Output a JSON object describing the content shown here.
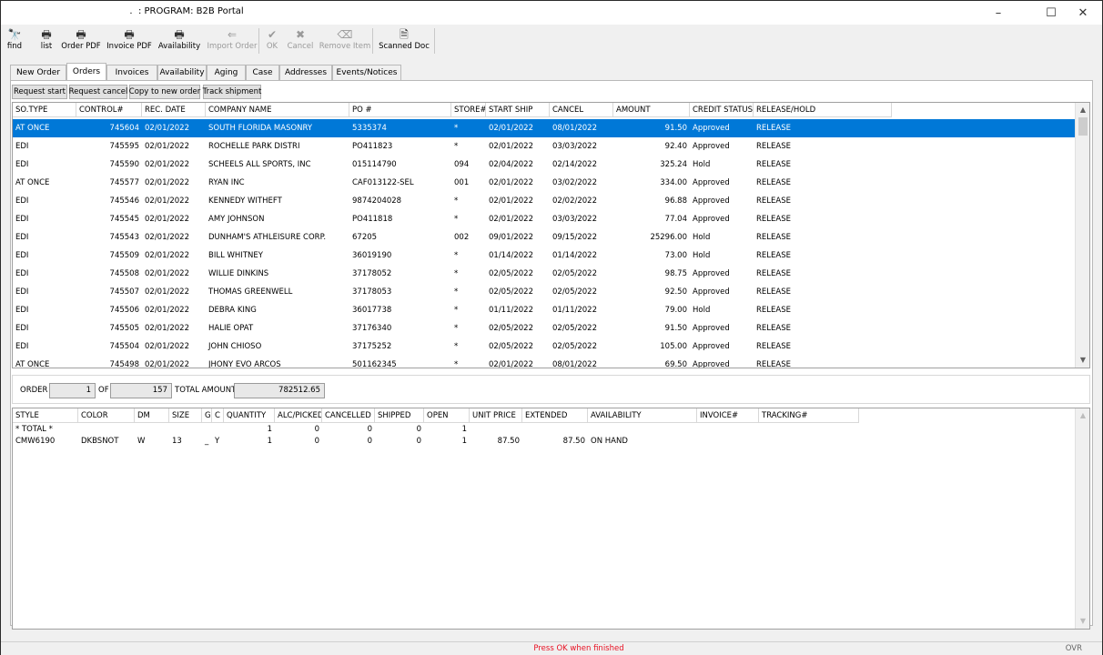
{
  "window": {
    "title": "        .  : PROGRAM: B2B Portal"
  },
  "toolbar": [
    {
      "label": "find",
      "icon": "binoculars-icon",
      "glyph": "🔭",
      "disabled": false
    },
    {
      "label": "list",
      "icon": "printer-icon",
      "glyph": "🖶",
      "disabled": false
    },
    {
      "label": "Order PDF",
      "icon": "printer-icon",
      "glyph": "🖶",
      "disabled": false
    },
    {
      "label": "Invoice PDF",
      "icon": "printer-icon",
      "glyph": "🖶",
      "disabled": false
    },
    {
      "label": "Availability",
      "icon": "printer-icon",
      "glyph": "🖶",
      "disabled": false
    },
    {
      "label": "Import Order",
      "icon": "import-icon",
      "glyph": "⇐",
      "disabled": true
    },
    {
      "label": "OK",
      "icon": "checkmark-icon",
      "glyph": "✔",
      "disabled": true
    },
    {
      "label": "Cancel",
      "icon": "x-icon",
      "glyph": "✖",
      "disabled": true
    },
    {
      "label": "Remove Item",
      "icon": "eraser-icon",
      "glyph": "⌫",
      "disabled": true
    },
    {
      "label": "Scanned Doc",
      "icon": "document-icon",
      "glyph": "🗎",
      "disabled": false
    }
  ],
  "tabs": [
    "New Order",
    "Orders",
    "Invoices",
    "Availability",
    "Aging",
    "Case",
    "Addresses",
    "Events/Notices"
  ],
  "active_tab": "Orders",
  "actions": [
    "Request start",
    "Request cancel",
    "Copy to new order",
    "Track shipment"
  ],
  "orders": {
    "columns": [
      "SO.TYPE",
      "CONTROL#",
      "REC. DATE",
      "COMPANY NAME",
      "PO #",
      "STORE#",
      "START SHIP",
      "CANCEL",
      "AMOUNT",
      "CREDIT STATUS",
      "RELEASE/HOLD"
    ],
    "rows": [
      [
        "AT ONCE",
        "745604",
        "02/01/2022",
        "SOUTH FLORIDA MASONRY",
        "5335374",
        "*",
        "02/01/2022",
        "08/01/2022",
        "91.50",
        "Approved",
        "RELEASE"
      ],
      [
        "EDI",
        "745595",
        "02/01/2022",
        "ROCHELLE PARK DISTRI",
        "PO411823",
        "*",
        "02/01/2022",
        "03/03/2022",
        "92.40",
        "Approved",
        "RELEASE"
      ],
      [
        "EDI",
        "745590",
        "02/01/2022",
        "SCHEELS ALL SPORTS, INC",
        "015114790",
        "094",
        "02/04/2022",
        "02/14/2022",
        "325.24",
        "Hold",
        "RELEASE"
      ],
      [
        "AT ONCE",
        "745577",
        "02/01/2022",
        "RYAN INC",
        "CAF013122-SEL",
        "001",
        "02/01/2022",
        "03/02/2022",
        "334.00",
        "Approved",
        "RELEASE"
      ],
      [
        "EDI",
        "745546",
        "02/01/2022",
        "KENNEDY WITHEFT",
        "9874204028",
        "*",
        "02/01/2022",
        "02/02/2022",
        "96.88",
        "Approved",
        "RELEASE"
      ],
      [
        "EDI",
        "745545",
        "02/01/2022",
        "AMY JOHNSON",
        "PO411818",
        "*",
        "02/01/2022",
        "03/03/2022",
        "77.04",
        "Approved",
        "RELEASE"
      ],
      [
        "EDI",
        "745543",
        "02/01/2022",
        "DUNHAM'S ATHLEISURE CORP.",
        "67205",
        "002",
        "09/01/2022",
        "09/15/2022",
        "25296.00",
        "Hold",
        "RELEASE"
      ],
      [
        "EDI",
        "745509",
        "02/01/2022",
        "BILL WHITNEY",
        "36019190",
        "*",
        "01/14/2022",
        "01/14/2022",
        "73.00",
        "Hold",
        "RELEASE"
      ],
      [
        "EDI",
        "745508",
        "02/01/2022",
        "WILLIE DINKINS",
        "37178052",
        "*",
        "02/05/2022",
        "02/05/2022",
        "98.75",
        "Approved",
        "RELEASE"
      ],
      [
        "EDI",
        "745507",
        "02/01/2022",
        "THOMAS GREENWELL",
        "37178053",
        "*",
        "02/05/2022",
        "02/05/2022",
        "92.50",
        "Approved",
        "RELEASE"
      ],
      [
        "EDI",
        "745506",
        "02/01/2022",
        "DEBRA KING",
        "36017738",
        "*",
        "01/11/2022",
        "01/11/2022",
        "79.00",
        "Hold",
        "RELEASE"
      ],
      [
        "EDI",
        "745505",
        "02/01/2022",
        "HALIE OPAT",
        "37176340",
        "*",
        "02/05/2022",
        "02/05/2022",
        "91.50",
        "Approved",
        "RELEASE"
      ],
      [
        "EDI",
        "745504",
        "02/01/2022",
        "JOHN CHIOSO",
        "37175252",
        "*",
        "02/05/2022",
        "02/05/2022",
        "105.00",
        "Approved",
        "RELEASE"
      ],
      [
        "AT ONCE",
        "745498",
        "02/01/2022",
        "JHONY EVO      ARCOS",
        "501162345",
        "*",
        "02/01/2022",
        "08/01/2022",
        "69.50",
        "Approved",
        "RELEASE"
      ]
    ]
  },
  "totals": {
    "order_label": "ORDER",
    "order_value": "1",
    "of_label": "OF",
    "of_value": "157",
    "total_label": "TOTAL AMOUNT",
    "total_value": "782512.65"
  },
  "details": {
    "columns": [
      "STYLE",
      "COLOR",
      "DM",
      "SIZE",
      "G",
      "C",
      "QUANTITY",
      "ALC/PICKED",
      "CANCELLED",
      "SHIPPED",
      "OPEN",
      "UNIT PRICE",
      "EXTENDED",
      "AVAILABILITY",
      "INVOICE#",
      "TRACKING#"
    ],
    "rows": [
      [
        "* TOTAL *",
        "",
        "",
        "",
        "",
        "",
        "1",
        "0",
        "0",
        "0",
        "1",
        "",
        "",
        "",
        "",
        ""
      ],
      [
        "CMW6190",
        "DKBSNOT",
        "W",
        "13",
        "_",
        "Y",
        "1",
        "0",
        "0",
        "0",
        "1",
        "87.50",
        "87.50",
        "ON HAND",
        "",
        ""
      ]
    ]
  },
  "status": {
    "message": "Press OK when finished",
    "mode": "OVR"
  }
}
